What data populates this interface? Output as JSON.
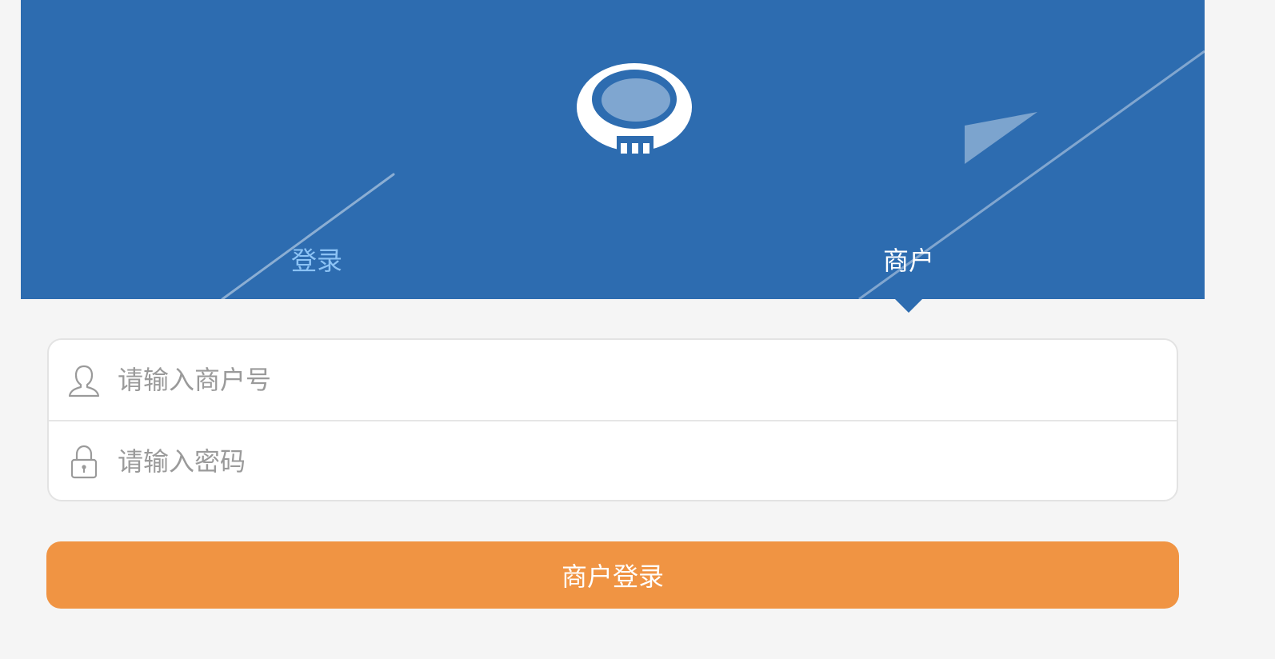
{
  "header": {
    "bg_color": "#2d6cb0",
    "logo_icon": "merchant-logo-icon",
    "tabs": [
      {
        "label": "登录",
        "active": false,
        "color": "#8cc3f5"
      },
      {
        "label": "商户",
        "active": true,
        "color": "#ffffff"
      }
    ]
  },
  "form": {
    "merchant_id": {
      "icon": "user-icon",
      "placeholder": "请输入商户号",
      "value": ""
    },
    "password": {
      "icon": "lock-icon",
      "placeholder": "请输入密码",
      "value": ""
    }
  },
  "submit": {
    "label": "商户登录",
    "color": "#f09443"
  }
}
